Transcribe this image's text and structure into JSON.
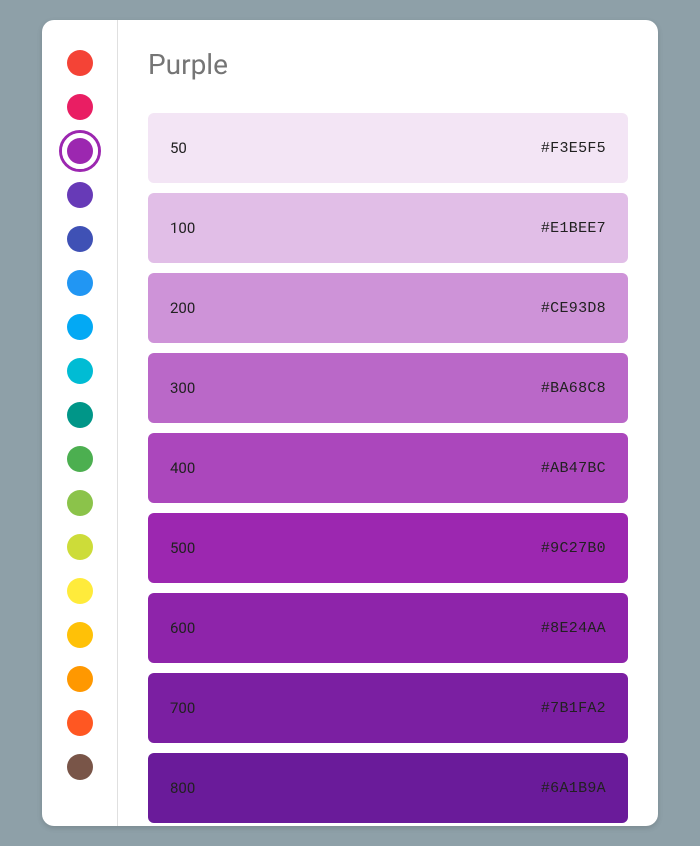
{
  "title": "Purple",
  "selected_index": 2,
  "sidebar": [
    {
      "name": "red",
      "color": "#F44336"
    },
    {
      "name": "pink",
      "color": "#E91E63"
    },
    {
      "name": "purple",
      "color": "#9C27B0"
    },
    {
      "name": "deep-purple",
      "color": "#673AB7"
    },
    {
      "name": "indigo",
      "color": "#3F51B5"
    },
    {
      "name": "blue",
      "color": "#2196F3"
    },
    {
      "name": "light-blue",
      "color": "#03A9F4"
    },
    {
      "name": "cyan",
      "color": "#00BCD4"
    },
    {
      "name": "teal",
      "color": "#009688"
    },
    {
      "name": "green",
      "color": "#4CAF50"
    },
    {
      "name": "light-green",
      "color": "#8BC34A"
    },
    {
      "name": "lime",
      "color": "#CDDC39"
    },
    {
      "name": "yellow",
      "color": "#FFEB3B"
    },
    {
      "name": "amber",
      "color": "#FFC107"
    },
    {
      "name": "orange",
      "color": "#FF9800"
    },
    {
      "name": "deep-orange",
      "color": "#FF5722"
    },
    {
      "name": "brown",
      "color": "#795548"
    }
  ],
  "shades": [
    {
      "label": "50",
      "hex": "#F3E5F5",
      "fg": "#212121"
    },
    {
      "label": "100",
      "hex": "#E1BEE7",
      "fg": "#212121"
    },
    {
      "label": "200",
      "hex": "#CE93D8",
      "fg": "#212121"
    },
    {
      "label": "300",
      "hex": "#BA68C8",
      "fg": "#212121"
    },
    {
      "label": "400",
      "hex": "#AB47BC",
      "fg": "#212121"
    },
    {
      "label": "500",
      "hex": "#9C27B0",
      "fg": "#212121"
    },
    {
      "label": "600",
      "hex": "#8E24AA",
      "fg": "#212121"
    },
    {
      "label": "700",
      "hex": "#7B1FA2",
      "fg": "#212121"
    },
    {
      "label": "800",
      "hex": "#6A1B9A",
      "fg": "#212121"
    }
  ]
}
